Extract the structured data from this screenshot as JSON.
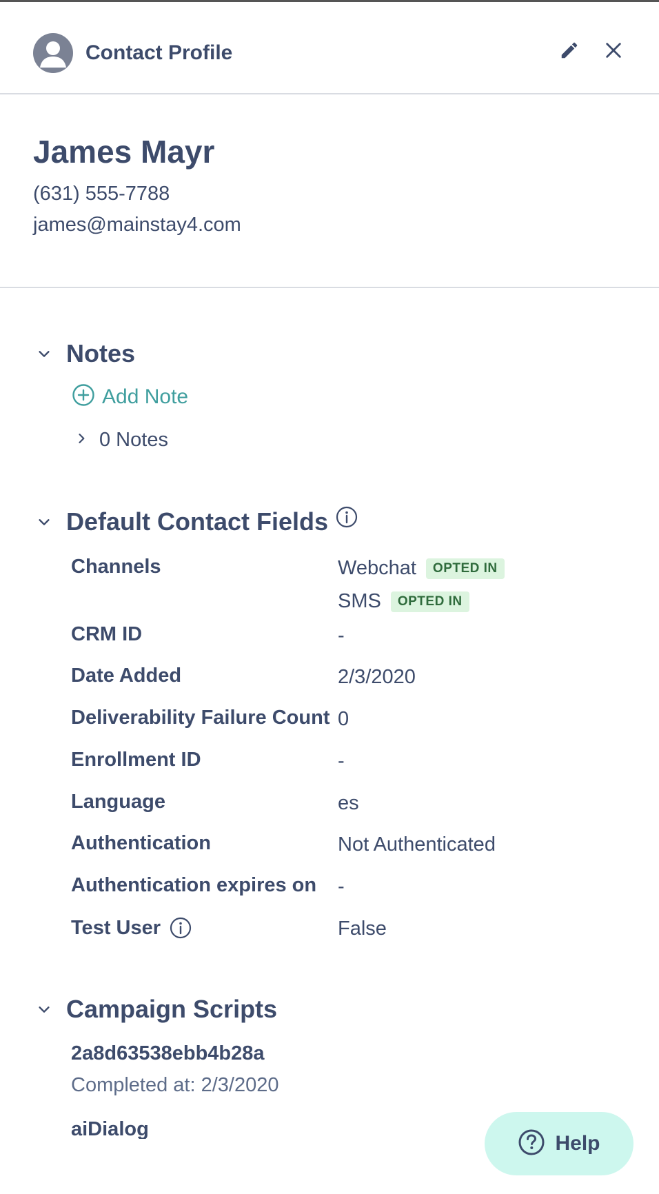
{
  "header": {
    "title": "Contact Profile",
    "avatar_icon": "user-avatar-icon",
    "edit_icon": "pencil-icon",
    "close_icon": "close-icon"
  },
  "contact": {
    "name": "James Mayr",
    "phone": "(631) 555-7788",
    "email": "james@mainstay4.com"
  },
  "notes": {
    "section_title": "Notes",
    "add_label": "Add Note",
    "count_label": "0 Notes"
  },
  "default_fields": {
    "section_title": "Default Contact Fields",
    "channels_label": "Channels",
    "channels": [
      {
        "name": "Webchat",
        "status": "OPTED IN"
      },
      {
        "name": "SMS",
        "status": "OPTED IN"
      }
    ],
    "rows": [
      {
        "label": "CRM ID",
        "value": "-"
      },
      {
        "label": "Date Added",
        "value": "2/3/2020"
      },
      {
        "label": "Deliverability Failure Count",
        "value": "0"
      },
      {
        "label": "Enrollment ID",
        "value": "-"
      },
      {
        "label": "Language",
        "value": "es"
      },
      {
        "label": "Authentication",
        "value": "Not Authenticated"
      },
      {
        "label": "Authentication expires on",
        "value": "-"
      },
      {
        "label": "Test User",
        "value": "False"
      }
    ]
  },
  "campaign_scripts": {
    "section_title": "Campaign Scripts",
    "items": [
      {
        "id": "2a8d63538ebb4b28a",
        "completed": "Completed at: 2/3/2020"
      },
      {
        "id": "aiDialog"
      }
    ]
  },
  "help": {
    "label": "Help"
  },
  "colors": {
    "text": "#3d4b6b",
    "accent": "#3f9e9e",
    "badge_bg": "#dcf4df",
    "badge_text": "#2f6b3c",
    "help_bg": "#cdf7ee"
  }
}
